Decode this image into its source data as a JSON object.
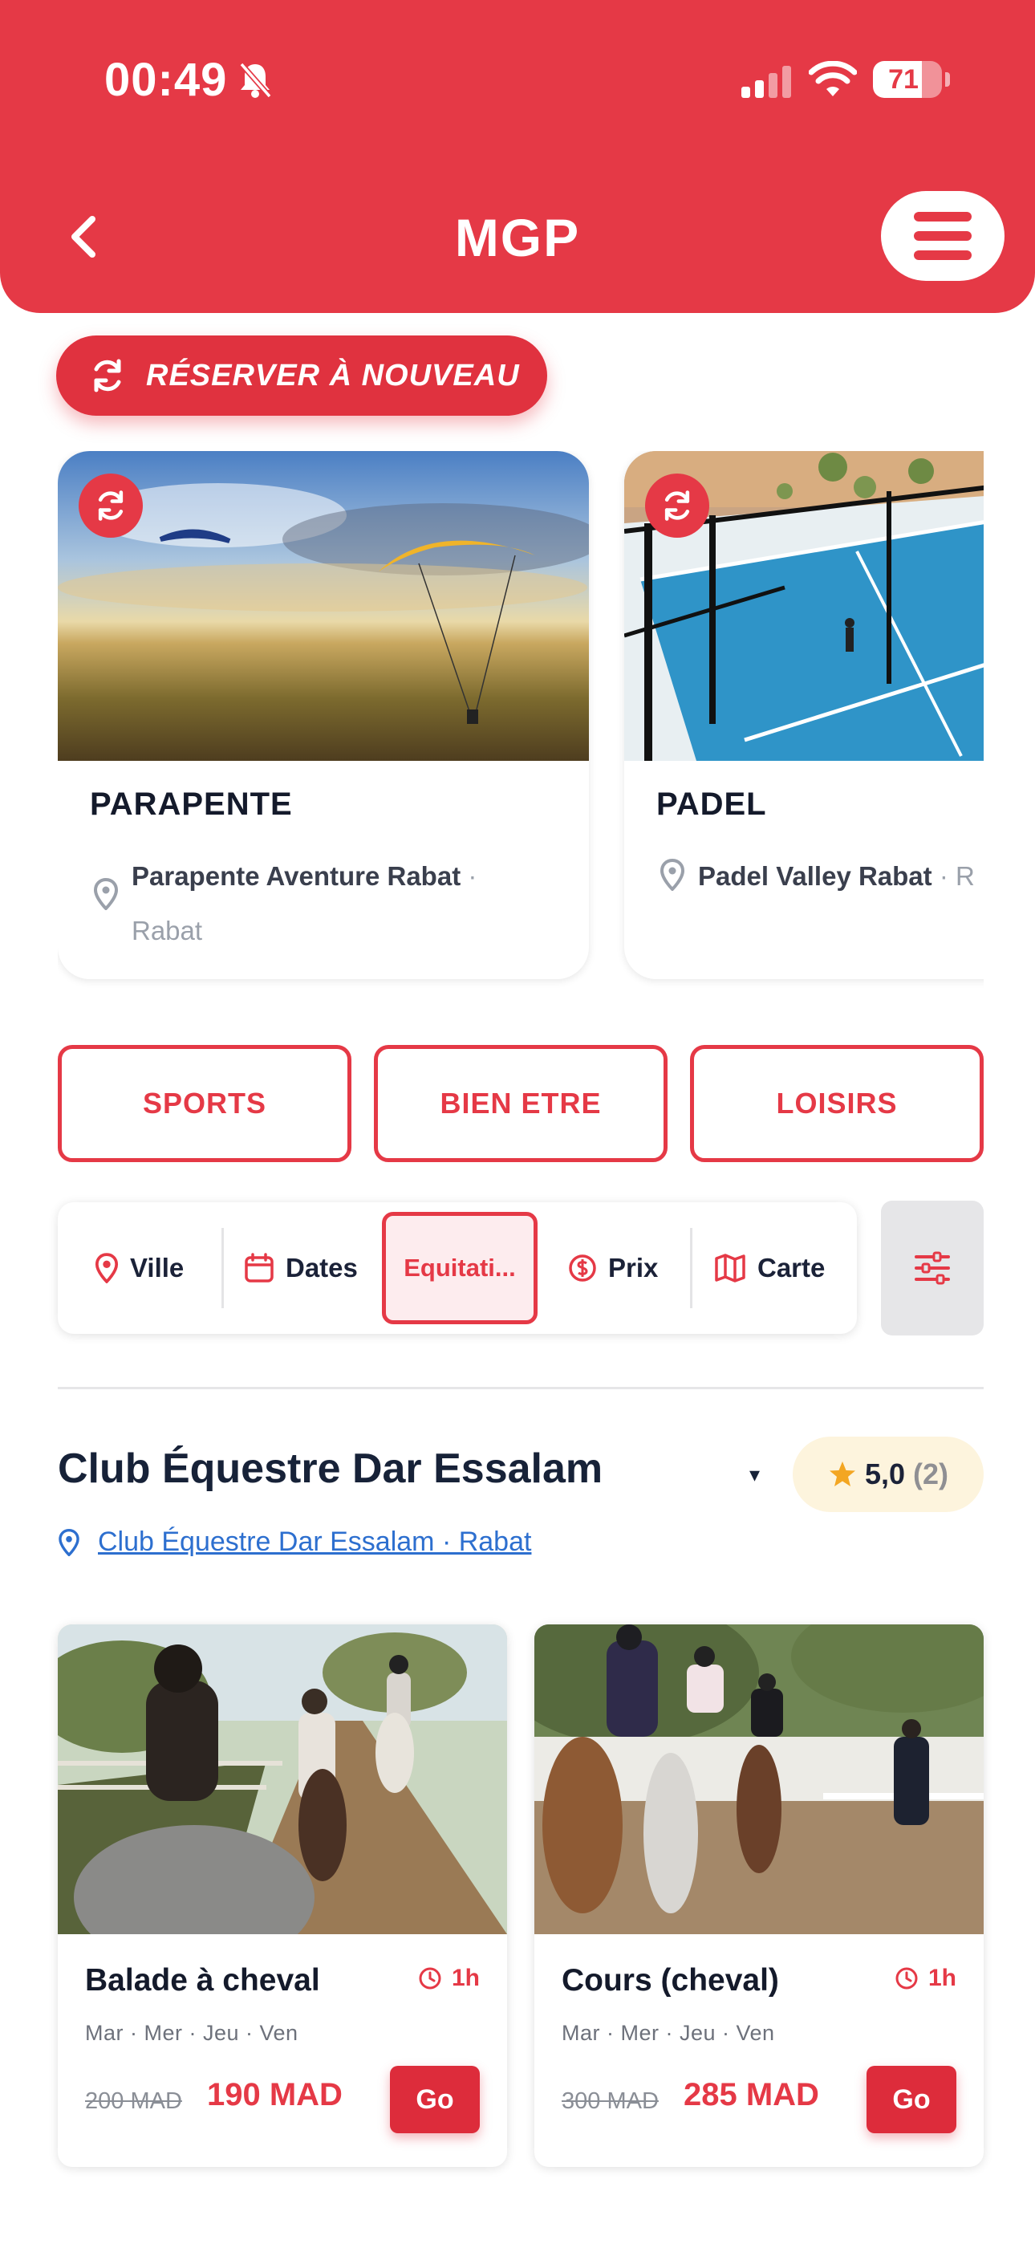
{
  "status_bar": {
    "time": "00:49",
    "battery": "71",
    "battery_level": 0.71
  },
  "header": {
    "title": "MGP"
  },
  "reserve_again": {
    "label": "RÉSERVER  À NOUVEAU"
  },
  "recent": [
    {
      "name": "PARAPENTE",
      "venue": "Parapente Aventure Rabat",
      "separator": " · ",
      "city": "Rabat"
    },
    {
      "name": "PADEL",
      "venue": "Padel Valley Rabat",
      "separator": " · ",
      "city": "R"
    }
  ],
  "categories": [
    "SPORTS",
    "BIEN ETRE",
    "LOISIRS"
  ],
  "filters": {
    "ville": "Ville",
    "dates": "Dates",
    "activity": "Equitati...",
    "prix": "Prix",
    "carte": "Carte"
  },
  "club": {
    "name": "Club Équestre Dar Essalam",
    "caret": "▾",
    "rating": "5,0",
    "rating_count": "(2)",
    "location": "Club Équestre Dar Essalam · Rabat"
  },
  "activities": [
    {
      "title": "Balade à cheval",
      "duration": "1h",
      "days": "Mar · Mer · Jeu · Ven",
      "old_price": "200 MAD",
      "price": "190 MAD",
      "cta": "Go"
    },
    {
      "title": "Cours (cheval)",
      "duration": "1h",
      "days": "Mar · Mer · Jeu · Ven",
      "old_price": "300 MAD",
      "price": "285 MAD",
      "cta": "Go"
    }
  ],
  "colors": {
    "accent": "#e53946",
    "link": "#2d6fcf",
    "rating_bg": "#fdf4dd"
  }
}
